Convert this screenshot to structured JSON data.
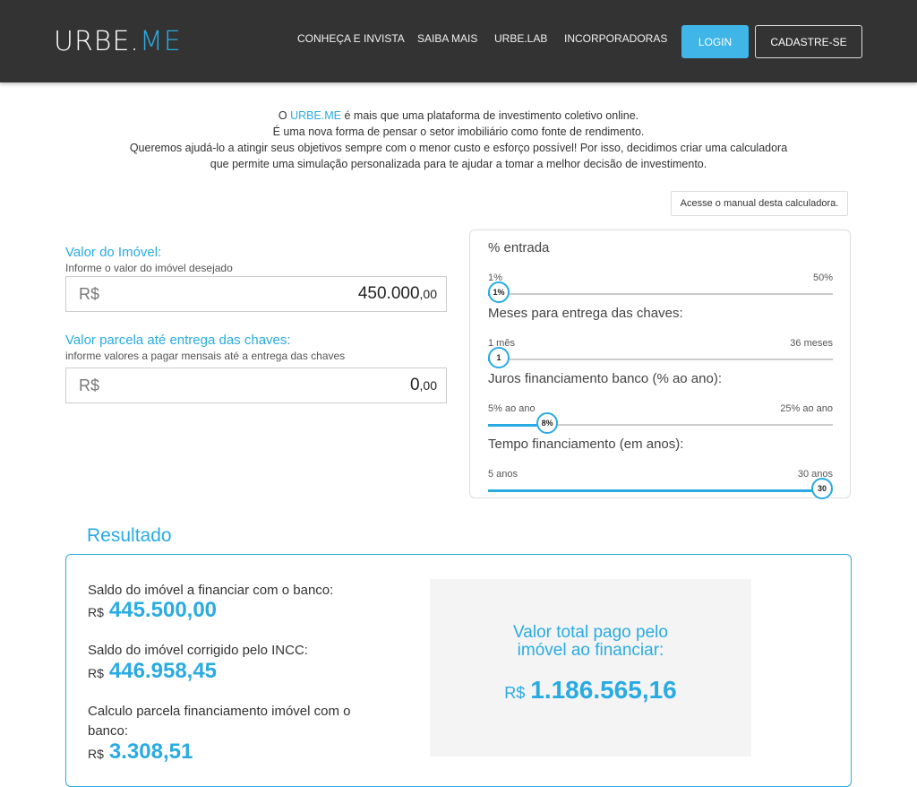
{
  "header": {
    "logo_part1": "URBE.",
    "logo_part2": "ME",
    "nav": [
      "CONHEÇA E INVISTA",
      "SAIBA MAIS",
      "URBE.LAB",
      "INCORPORADORAS"
    ],
    "login_label": "LOGIN",
    "signup_label": "CADASTRE-SE"
  },
  "intro": {
    "line1_prefix": "O ",
    "line1_brand": "URBE.ME",
    "line1_suffix": " é mais que uma plataforma de investimento coletivo online.",
    "line2": "É uma nova forma de pensar o setor imobiliário como fonte de rendimento.",
    "line3": "Queremos ajudá-lo a atingir seus objetivos sempre com o menor custo e esforço possível! Por isso, decidimos criar uma calculadora",
    "line4": "que permite uma simulação personalizada para te ajudar a tomar a melhor decisão de investimento."
  },
  "manual_button": "Acesse o manual desta calculadora.",
  "inputs": {
    "property_value": {
      "label": "Valor do Imóvel:",
      "hint": "Informe o valor do imóvel desejado",
      "currency": "R$",
      "value_int": "450.000",
      "value_dec": ",00"
    },
    "installment_value": {
      "label": "Valor parcela até entrega das chaves:",
      "hint": "informe valores a pagar mensais até a entrega das chaves",
      "currency": "R$",
      "value_int": "0",
      "value_dec": ",00"
    }
  },
  "sliders": [
    {
      "title": "% entrada",
      "min_label": "1%",
      "max_label": "50%",
      "thumb_label": "1%",
      "min": 1,
      "max": 50,
      "value": 1
    },
    {
      "title": "Meses para entrega das chaves:",
      "min_label": "1 mês",
      "max_label": "36 meses",
      "thumb_label": "1",
      "min": 1,
      "max": 36,
      "value": 1
    },
    {
      "title": "Juros financiamento banco (% ao ano):",
      "min_label": "5% ao ano",
      "max_label": "25% ao ano",
      "thumb_label": "8%",
      "min": 5,
      "max": 25,
      "value": 8
    },
    {
      "title": "Tempo financiamento (em anos):",
      "min_label": "5 anos",
      "max_label": "30 anos",
      "thumb_label": "30",
      "min": 5,
      "max": 30,
      "value": 30
    }
  ],
  "result": {
    "title": "Resultado",
    "items": [
      {
        "label": "Saldo do imóvel a financiar com o banco:",
        "currency": "R$",
        "value": "445.500,00"
      },
      {
        "label": "Saldo do imóvel corrigido pelo INCC:",
        "currency": "R$",
        "value": "446.958,45"
      },
      {
        "label": "Calculo parcela financiamento imóvel com o banco:",
        "currency": "R$",
        "value": "3.308,51"
      }
    ],
    "total_label_line1": "Valor total pago pelo",
    "total_label_line2": "imóvel ao financiar:",
    "total_currency": "R$",
    "total_value": "1.186.565,16"
  },
  "colors": {
    "accent": "#29abe2",
    "navbar": "#333333"
  }
}
